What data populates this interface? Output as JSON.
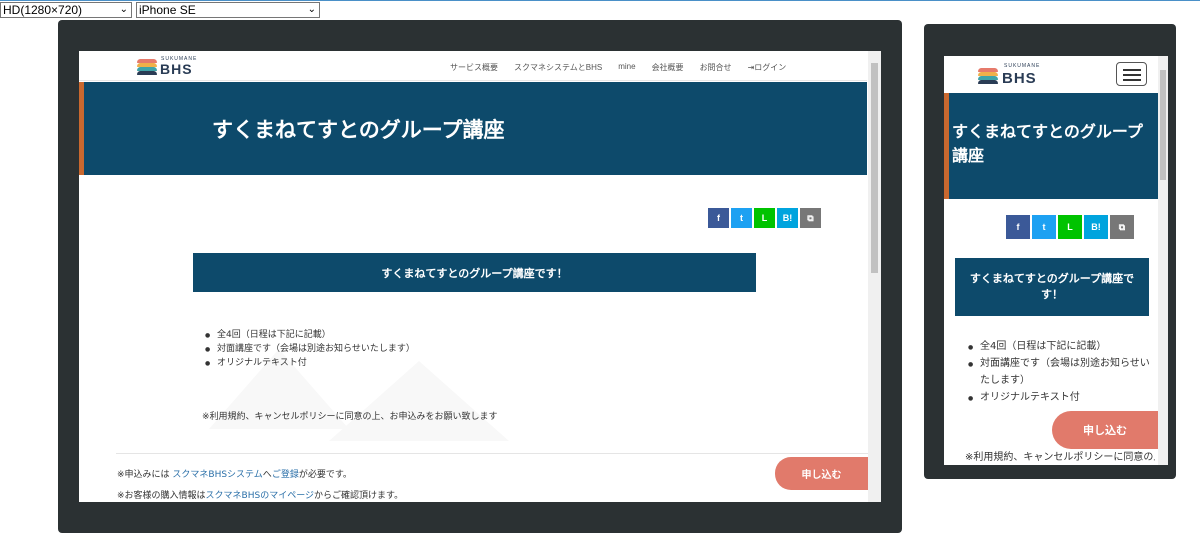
{
  "toolbar": {
    "resolution_select": "HD(1280×720)",
    "device_select": "iPhone SE"
  },
  "site": {
    "logo_text": "BHS",
    "logo_sub": "SUKUMANE",
    "nav": [
      "サービス概要",
      "スクマネシステムとBHS",
      "mine",
      "会社概要",
      "お問合せ",
      "ログイン"
    ],
    "hero_title": "すくまねてすとのグループ講座",
    "share": {
      "facebook": "f",
      "twitter": "t",
      "line": "L",
      "hatena": "B!",
      "copy": "⧉"
    },
    "banner": "すくまねてすとのグループ講座です！",
    "features": [
      "全4回（日程は下記に記載）",
      "対面講座です（会場は別途お知らせいたします）",
      "オリジナルテキスト付"
    ],
    "policy_note": "※利用規約、キャンセルポリシーに同意の上、お申込みをお願い致します",
    "signup_prefix": "※申込みには ",
    "signup_link1": "スクマネBHSシステム",
    "signup_mid": "へ",
    "signup_link2": "ご登録",
    "signup_suffix": "が必要です。",
    "mypage_prefix": "※お客様の購入情報は",
    "mypage_link": "スクマネBHSのマイページ",
    "mypage_suffix": "からご確認頂けます。",
    "cta": "申し込む"
  },
  "colors": {
    "navy": "#0d4a6b",
    "accent": "#c9682f",
    "cta": "#e17a6b",
    "frame": "#2b3133"
  }
}
